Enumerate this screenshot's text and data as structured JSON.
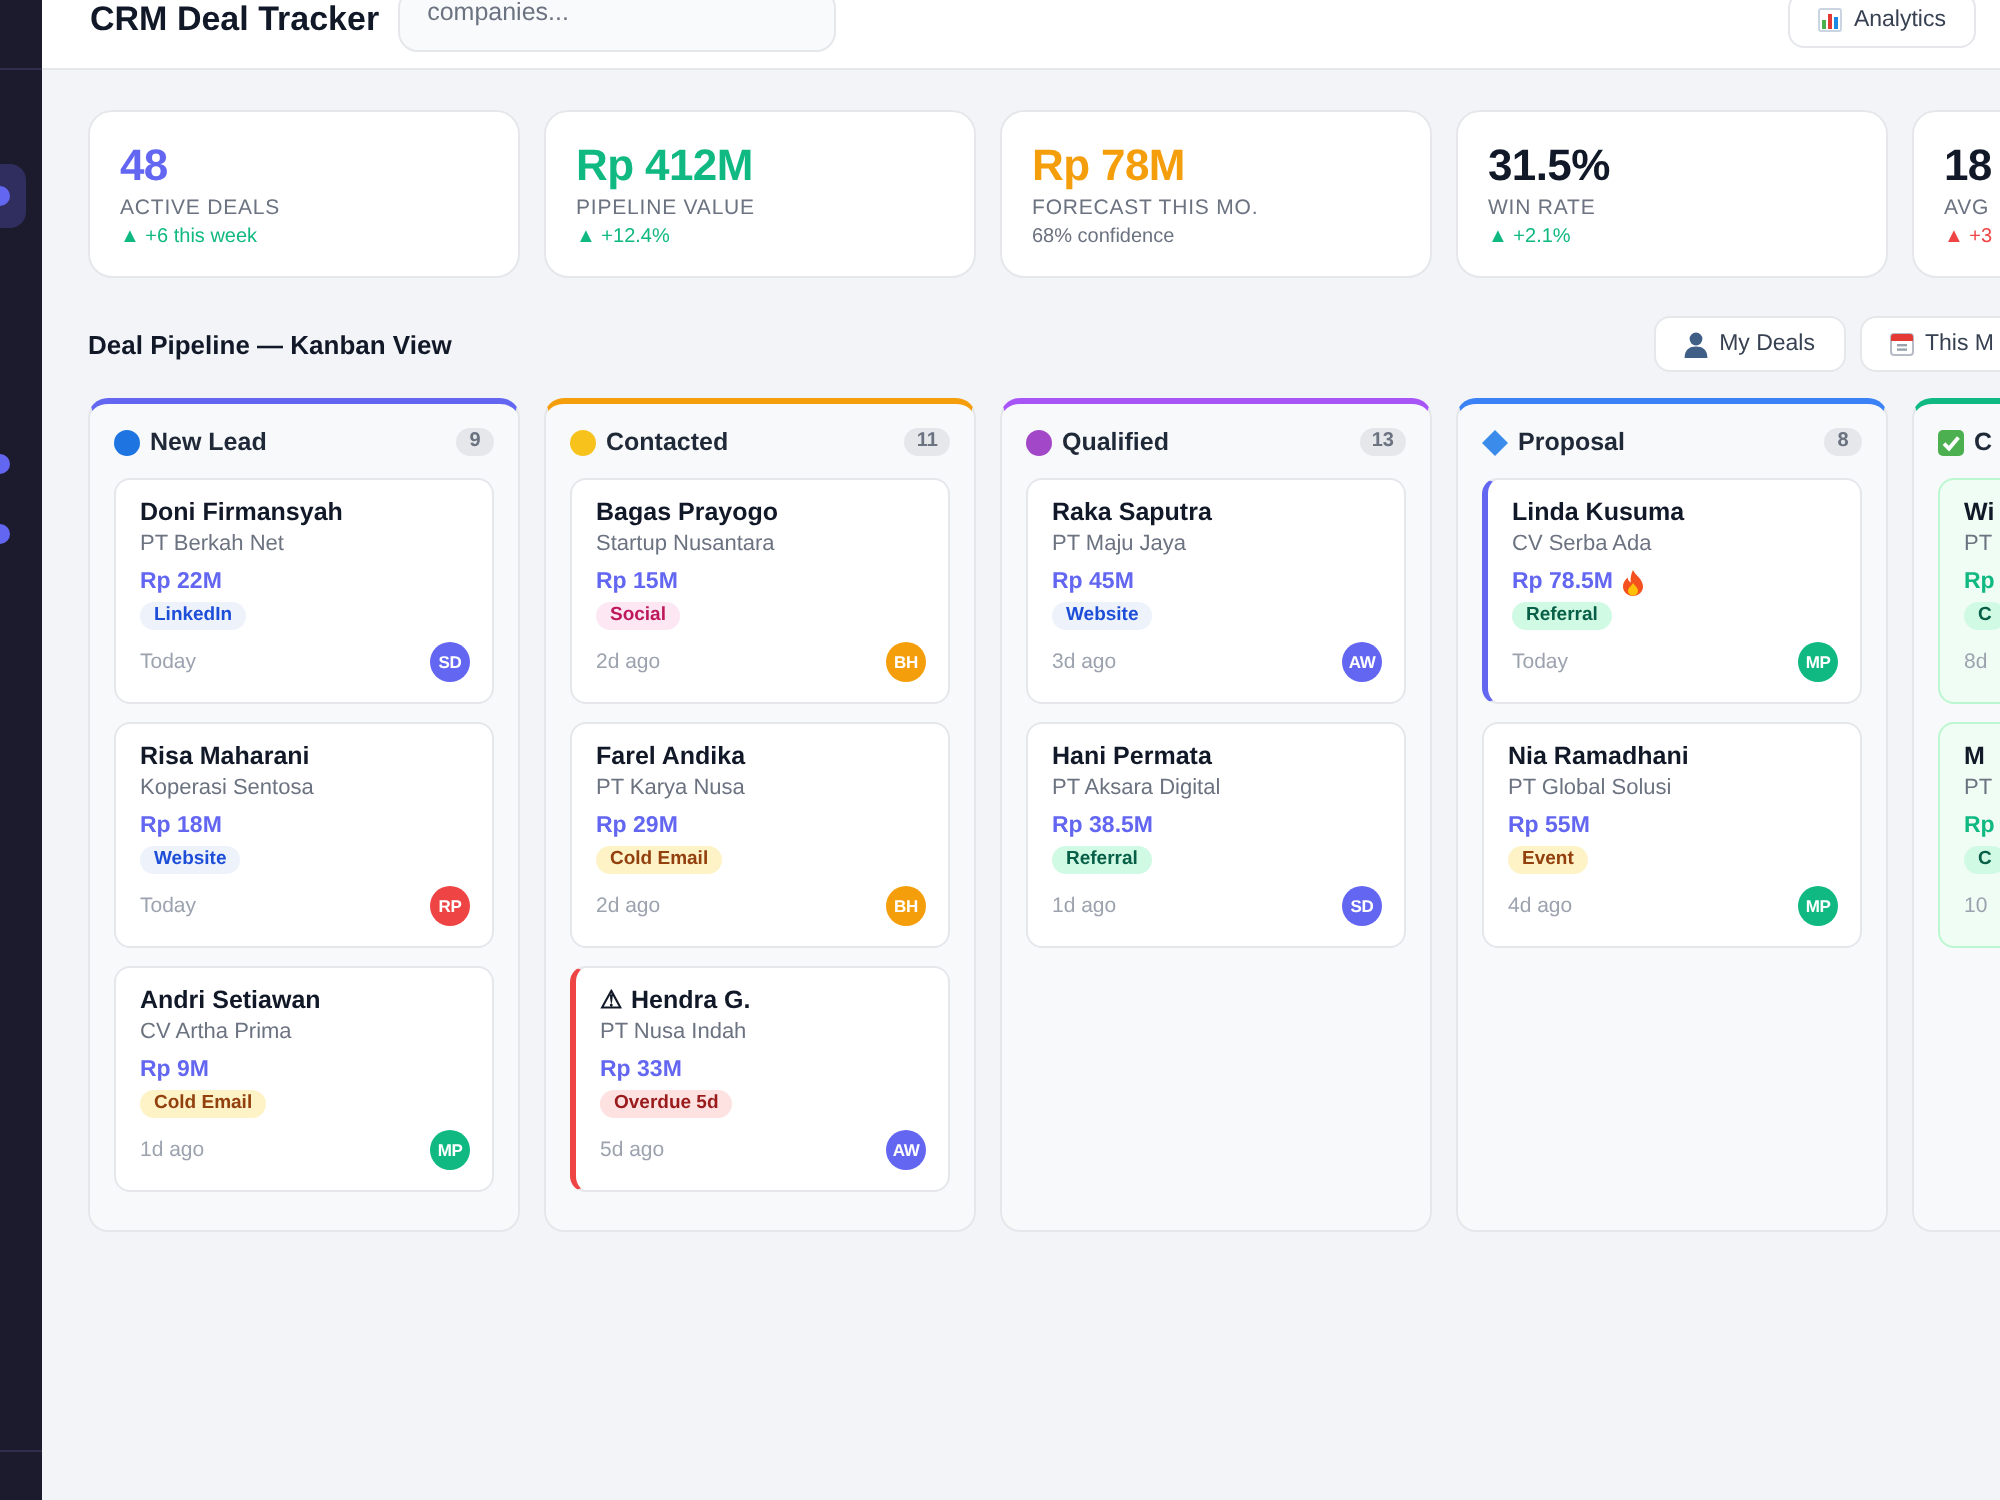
{
  "sidebar": {
    "items": [
      {
        "selected": true
      },
      {
        "selected": false
      },
      {
        "selected": false
      }
    ]
  },
  "header": {
    "title": "CRM Deal Tracker",
    "search": {
      "placeholder": "companies..."
    },
    "action": {
      "label": "Analytics"
    }
  },
  "stats": [
    {
      "value": "48",
      "label": "ACTIVE DEALS",
      "note": "▲ +6 this week",
      "color": "#6366f1",
      "kind": "positive"
    },
    {
      "value": "Rp 412M",
      "label": "PIPELINE VALUE",
      "note": "▲ +12.4%",
      "color": "#10b981",
      "kind": "positive"
    },
    {
      "value": "Rp 78M",
      "label": "FORECAST THIS MO.",
      "note": "68% confidence",
      "color": "#f59e0b",
      "kind": "neutral"
    },
    {
      "value": "31.5%",
      "label": "WIN RATE",
      "note": "▲ +2.1%",
      "color": "#111827",
      "kind": "positive"
    },
    {
      "value": "18",
      "label": "AVG",
      "note": "▲ +3",
      "color": "#111827",
      "kind": "negative"
    }
  ],
  "board": {
    "title": "Deal Pipeline — Kanban View",
    "filters": [
      {
        "label": "My Deals",
        "kind": "owner"
      },
      {
        "label": "This M",
        "kind": "period"
      }
    ],
    "columns": [
      {
        "title": "New Lead",
        "count": "9",
        "marker": {
          "kind": "circle",
          "color": "#1e74e0"
        },
        "color": "#6366f1",
        "cards": [
          {
            "name": "Doni Firmansyah",
            "company": "PT Berkah Net",
            "value": "Rp 22M",
            "tag": {
              "text": "LinkedIn",
              "kind": "info"
            },
            "time": "Today",
            "avatar": {
              "initials": "SD",
              "color": "#6366f1"
            },
            "kind": "normal"
          },
          {
            "name": "Risa Maharani",
            "company": "Koperasi Sentosa",
            "value": "Rp 18M",
            "tag": {
              "text": "Website",
              "kind": "info"
            },
            "time": "Today",
            "avatar": {
              "initials": "RP",
              "color": "#ef4444"
            },
            "kind": "normal"
          },
          {
            "name": "Andri Setiawan",
            "company": "CV Artha Prima",
            "value": "Rp 9M",
            "tag": {
              "text": "Cold Email",
              "kind": "warm"
            },
            "time": "1d ago",
            "avatar": {
              "initials": "MP",
              "color": "#10b981"
            },
            "kind": "normal"
          }
        ]
      },
      {
        "title": "Contacted",
        "count": "11",
        "marker": {
          "kind": "circle",
          "color": "#f8c21c"
        },
        "color": "#f59e0b",
        "cards": [
          {
            "name": "Bagas Prayogo",
            "company": "Startup Nusantara",
            "value": "Rp 15M",
            "tag": {
              "text": "Social",
              "kind": "social"
            },
            "time": "2d ago",
            "avatar": {
              "initials": "BH",
              "color": "#f59e0b"
            },
            "kind": "normal"
          },
          {
            "name": "Farel Andika",
            "company": "PT Karya Nusa",
            "value": "Rp 29M",
            "tag": {
              "text": "Cold Email",
              "kind": "warm"
            },
            "time": "2d ago",
            "avatar": {
              "initials": "BH",
              "color": "#f59e0b"
            },
            "kind": "normal"
          },
          {
            "name": "⚠ Hendra G.",
            "company": "PT Nusa Indah",
            "value": "Rp 33M",
            "tag": {
              "text": "Overdue 5d",
              "kind": "danger"
            },
            "time": "5d ago",
            "avatar": {
              "initials": "AW",
              "color": "#6366f1"
            },
            "kind": "overdue"
          }
        ]
      },
      {
        "title": "Qualified",
        "count": "13",
        "marker": {
          "kind": "circle",
          "color": "#a347c9"
        },
        "color": "#a855f7",
        "cards": [
          {
            "name": "Raka Saputra",
            "company": "PT Maju Jaya",
            "value": "Rp 45M",
            "tag": {
              "text": "Website",
              "kind": "info"
            },
            "time": "3d ago",
            "avatar": {
              "initials": "AW",
              "color": "#6366f1"
            },
            "kind": "normal"
          },
          {
            "name": "Hani Permata",
            "company": "PT Aksara Digital",
            "value": "Rp 38.5M",
            "tag": {
              "text": "Referral",
              "kind": "success"
            },
            "time": "1d ago",
            "avatar": {
              "initials": "SD",
              "color": "#6366f1"
            },
            "kind": "normal"
          }
        ]
      },
      {
        "title": "Proposal",
        "count": "8",
        "marker": {
          "kind": "diamond",
          "color": "#3b8beb"
        },
        "color": "#3b82f6",
        "cards": [
          {
            "name": "Linda Kusuma",
            "company": "CV Serba Ada",
            "value": "Rp 78.5M",
            "tag": {
              "text": "Referral",
              "kind": "success"
            },
            "time": "Today",
            "avatar": {
              "initials": "MP",
              "color": "#10b981"
            },
            "kind": "hot"
          },
          {
            "name": "Nia Ramadhani",
            "company": "PT Global Solusi",
            "value": "Rp 55M",
            "tag": {
              "text": "Event",
              "kind": "warm"
            },
            "time": "4d ago",
            "avatar": {
              "initials": "MP",
              "color": "#10b981"
            },
            "kind": "normal"
          }
        ]
      },
      {
        "title": "C",
        "marker": {
          "kind": "check",
          "color": "#4caf50"
        },
        "color": "#10b981",
        "cards": [
          {
            "name": "Wi",
            "company": "PT",
            "value": "Rp",
            "tag": {
              "text": "C",
              "kind": "success"
            },
            "time": "8d",
            "kind": "won"
          },
          {
            "name": "M",
            "company": "PT",
            "value": "Rp",
            "tag": {
              "text": "C",
              "kind": "success"
            },
            "time": "10",
            "kind": "won"
          }
        ]
      }
    ]
  }
}
